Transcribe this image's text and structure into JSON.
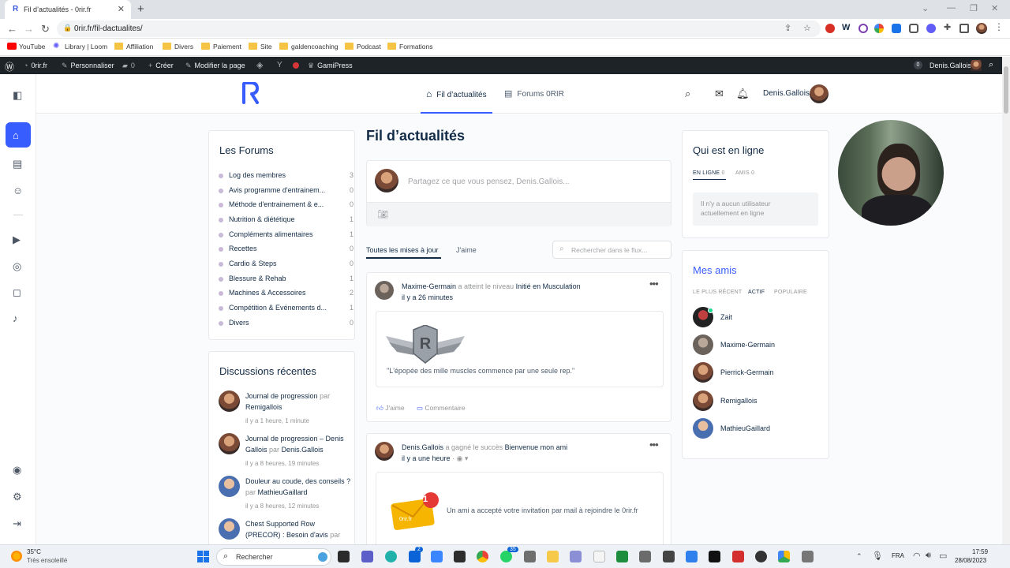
{
  "browser": {
    "tab_title": "Fil d’actualités - 0rir.fr",
    "url": "0rir.fr/fil-dactualites/",
    "bookmarks": [
      "YouTube",
      "Library | Loom",
      "Affiliation",
      "Divers",
      "Paiement",
      "Site",
      "galdencoaching",
      "Podcast",
      "Formations"
    ]
  },
  "wp_admin": {
    "site": "0rir.fr",
    "customize": "Personnaliser",
    "comments": "0",
    "new": "Créer",
    "edit": "Modifier la page",
    "gamipress": "GamiPress",
    "user_count": "0",
    "user": "Denis.Gallois"
  },
  "header": {
    "nav": [
      "Fil d’actualités",
      "Forums 0RIR"
    ],
    "user": "Denis.Gallois"
  },
  "forums": {
    "title": "Les Forums",
    "items": [
      {
        "label": "Log des membres",
        "count": "3"
      },
      {
        "label": "Avis programme d'entrainem...",
        "count": "0"
      },
      {
        "label": "Méthode d'entrainement & e...",
        "count": "0"
      },
      {
        "label": "Nutrition & diététique",
        "count": "1"
      },
      {
        "label": "Compléments alimentaires",
        "count": "1"
      },
      {
        "label": "Recettes",
        "count": "0"
      },
      {
        "label": "Cardio & Steps",
        "count": "0"
      },
      {
        "label": "Blessure & Rehab",
        "count": "1"
      },
      {
        "label": "Machines & Accessoires",
        "count": "2"
      },
      {
        "label": "Compétition & Evénements d...",
        "count": "1"
      },
      {
        "label": "Divers",
        "count": "0"
      }
    ]
  },
  "discussions": {
    "title": "Discussions récentes",
    "items": [
      {
        "topic": "Journal de progression",
        "by": "par",
        "author": "Remigallois",
        "time": "il y a 1 heure, 1 minute"
      },
      {
        "topic": "Journal de progression – Denis Gallois",
        "by": "par",
        "author": "Denis.Gallois",
        "time": "il y a 8 heures, 19 minutes"
      },
      {
        "topic": "Douleur au coude, des conseils ?",
        "by": "par",
        "author": "MathieuGaillard",
        "time": "il y a 8 heures, 12 minutes"
      },
      {
        "topic": "Chest Supported Row (PRECOR) : Besoin d'avis",
        "by": "par",
        "author": "",
        "time": ""
      }
    ]
  },
  "feed": {
    "title": "Fil d’actualités",
    "composer_placeholder": "Partagez ce que vous pensez, Denis.Gallois...",
    "tabs": [
      "Toutes les mises à jour",
      "J'aime"
    ],
    "search_placeholder": "Rechercher dans le flux...",
    "posts": [
      {
        "author": "Maxime-Germain",
        "verb": "a atteint le niveau",
        "object": "Initié en Musculation",
        "time": "il y a 26 minutes",
        "quote": "\"L'épopée des mille muscles commence par une seule rep.\"",
        "like": "J'aime",
        "comment": "Commentaire"
      },
      {
        "author": "Denis.Gallois",
        "verb": "a gagné le succès",
        "object": "Bienvenue mon ami",
        "time": "il y a une heure",
        "badge_count": "1",
        "badge_text": "0rir.fr",
        "text": "Un ami a accepté votre invitation par mail à rejoindre le 0rir.fr"
      }
    ]
  },
  "online": {
    "title": "Qui est en ligne",
    "tab_online": "EN LIGNE",
    "tab_online_count": "0",
    "tab_friends": "AMIS",
    "tab_friends_count": "0",
    "empty": "Il n'y a aucun utilisateur actuellement en ligne"
  },
  "friends": {
    "title": "Mes amis",
    "tabs": [
      "LE PLUS RÉCENT",
      "ACTIF",
      "POPULAIRE"
    ],
    "items": [
      "Zait",
      "Maxime-Germain",
      "Pierrick-Germain",
      "Remigallois",
      "MathieuGaillard"
    ]
  },
  "taskbar": {
    "weather_temp": "35°C",
    "weather_desc": "Très ensoleillé",
    "search": "Rechercher",
    "lang": "FRA",
    "time": "17:59",
    "date": "28/08/2023",
    "badge_mail": "2",
    "badge_whatsapp": "35"
  },
  "colors": {
    "accent": "#385dff",
    "text": "#122b46",
    "muted": "#939597",
    "wpbar": "#1d2327"
  }
}
